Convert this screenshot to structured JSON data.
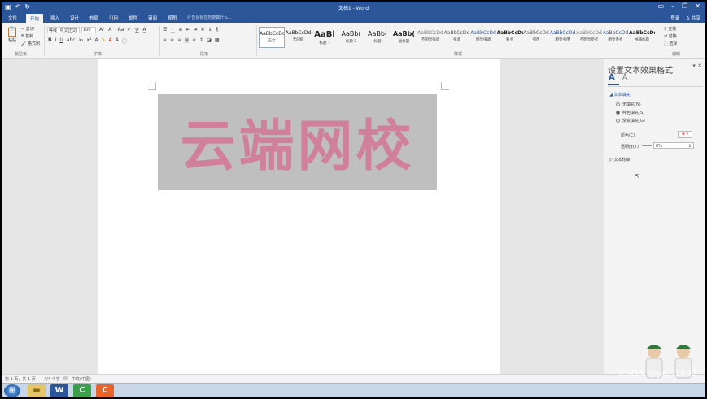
{
  "titlebar": {
    "quick_access": [
      "save-icon",
      "undo-icon",
      "redo-icon"
    ],
    "title": "文档1 - Word",
    "window_buttons": [
      "ribbon-display-icon",
      "minimize-icon",
      "restore-icon",
      "close-icon"
    ]
  },
  "tabs": [
    {
      "label": "文件"
    },
    {
      "label": "开始"
    },
    {
      "label": "插入"
    },
    {
      "label": "设计"
    },
    {
      "label": "布局"
    },
    {
      "label": "引用"
    },
    {
      "label": "邮件"
    },
    {
      "label": "审阅"
    },
    {
      "label": "视图"
    }
  ],
  "tell_me": "告诉我您想要做什么...",
  "account": {
    "login": "登录",
    "share": "共享"
  },
  "ribbon": {
    "clipboard": {
      "paste": "粘贴",
      "cut": "剪切",
      "copy": "复制",
      "format_painter": "格式刷",
      "label": "剪贴板"
    },
    "font": {
      "font_name": "等线 (中文正文)",
      "font_size": "100",
      "label": "字体"
    },
    "paragraph": {
      "label": "段落"
    },
    "styles": {
      "label": "样式",
      "items": [
        {
          "preview": "AaBbCcDd",
          "name": "正文"
        },
        {
          "preview": "AaBbCcDd",
          "name": "无间隔"
        },
        {
          "preview": "AaBl",
          "name": "标题 1"
        },
        {
          "preview": "AaBb(",
          "name": "标题 2"
        },
        {
          "preview": "AaBb(",
          "name": "标题"
        },
        {
          "preview": "AaBb(",
          "name": "副标题"
        },
        {
          "preview": "AaBbCcDd",
          "name": "不明显强调"
        },
        {
          "preview": "AaBbCcDd",
          "name": "强调"
        },
        {
          "preview": "AaBbCcDd",
          "name": "明显强调"
        },
        {
          "preview": "AaBbCcDd",
          "name": "要点"
        },
        {
          "preview": "AaBbCcDd",
          "name": "引用"
        },
        {
          "preview": "AaBbCcDd",
          "name": "明显引用"
        },
        {
          "preview": "AaBbCcDd",
          "name": "不明显参考"
        },
        {
          "preview": "AaBbCcDd",
          "name": "明显参考"
        },
        {
          "preview": "AaBbCcDd",
          "name": "书籍标题"
        }
      ]
    },
    "editing": {
      "find": "查找",
      "replace": "替换",
      "select": "选择",
      "label": "编辑"
    }
  },
  "document": {
    "wordart_text": "云端网校",
    "wordart_color": "#d0809a",
    "textbox_fill": "#bfbfbf"
  },
  "pane": {
    "title": "设置文本效果格式",
    "section_fill": "文本填充",
    "options": [
      {
        "label": "无填充(N)",
        "selected": false
      },
      {
        "label": "纯色填充(S)",
        "selected": true
      },
      {
        "label": "渐变填充(G)",
        "selected": false
      }
    ],
    "color_label": "颜色(C)",
    "transparency_label": "透明度(T)",
    "transparency_value": "0%",
    "section_outline": "文本轮廓"
  },
  "status": {
    "page": "第 1 页，共 1 页",
    "words": "4/4 个字",
    "language": "中文(中国)"
  },
  "watermark": "CSDN @yezi1993"
}
